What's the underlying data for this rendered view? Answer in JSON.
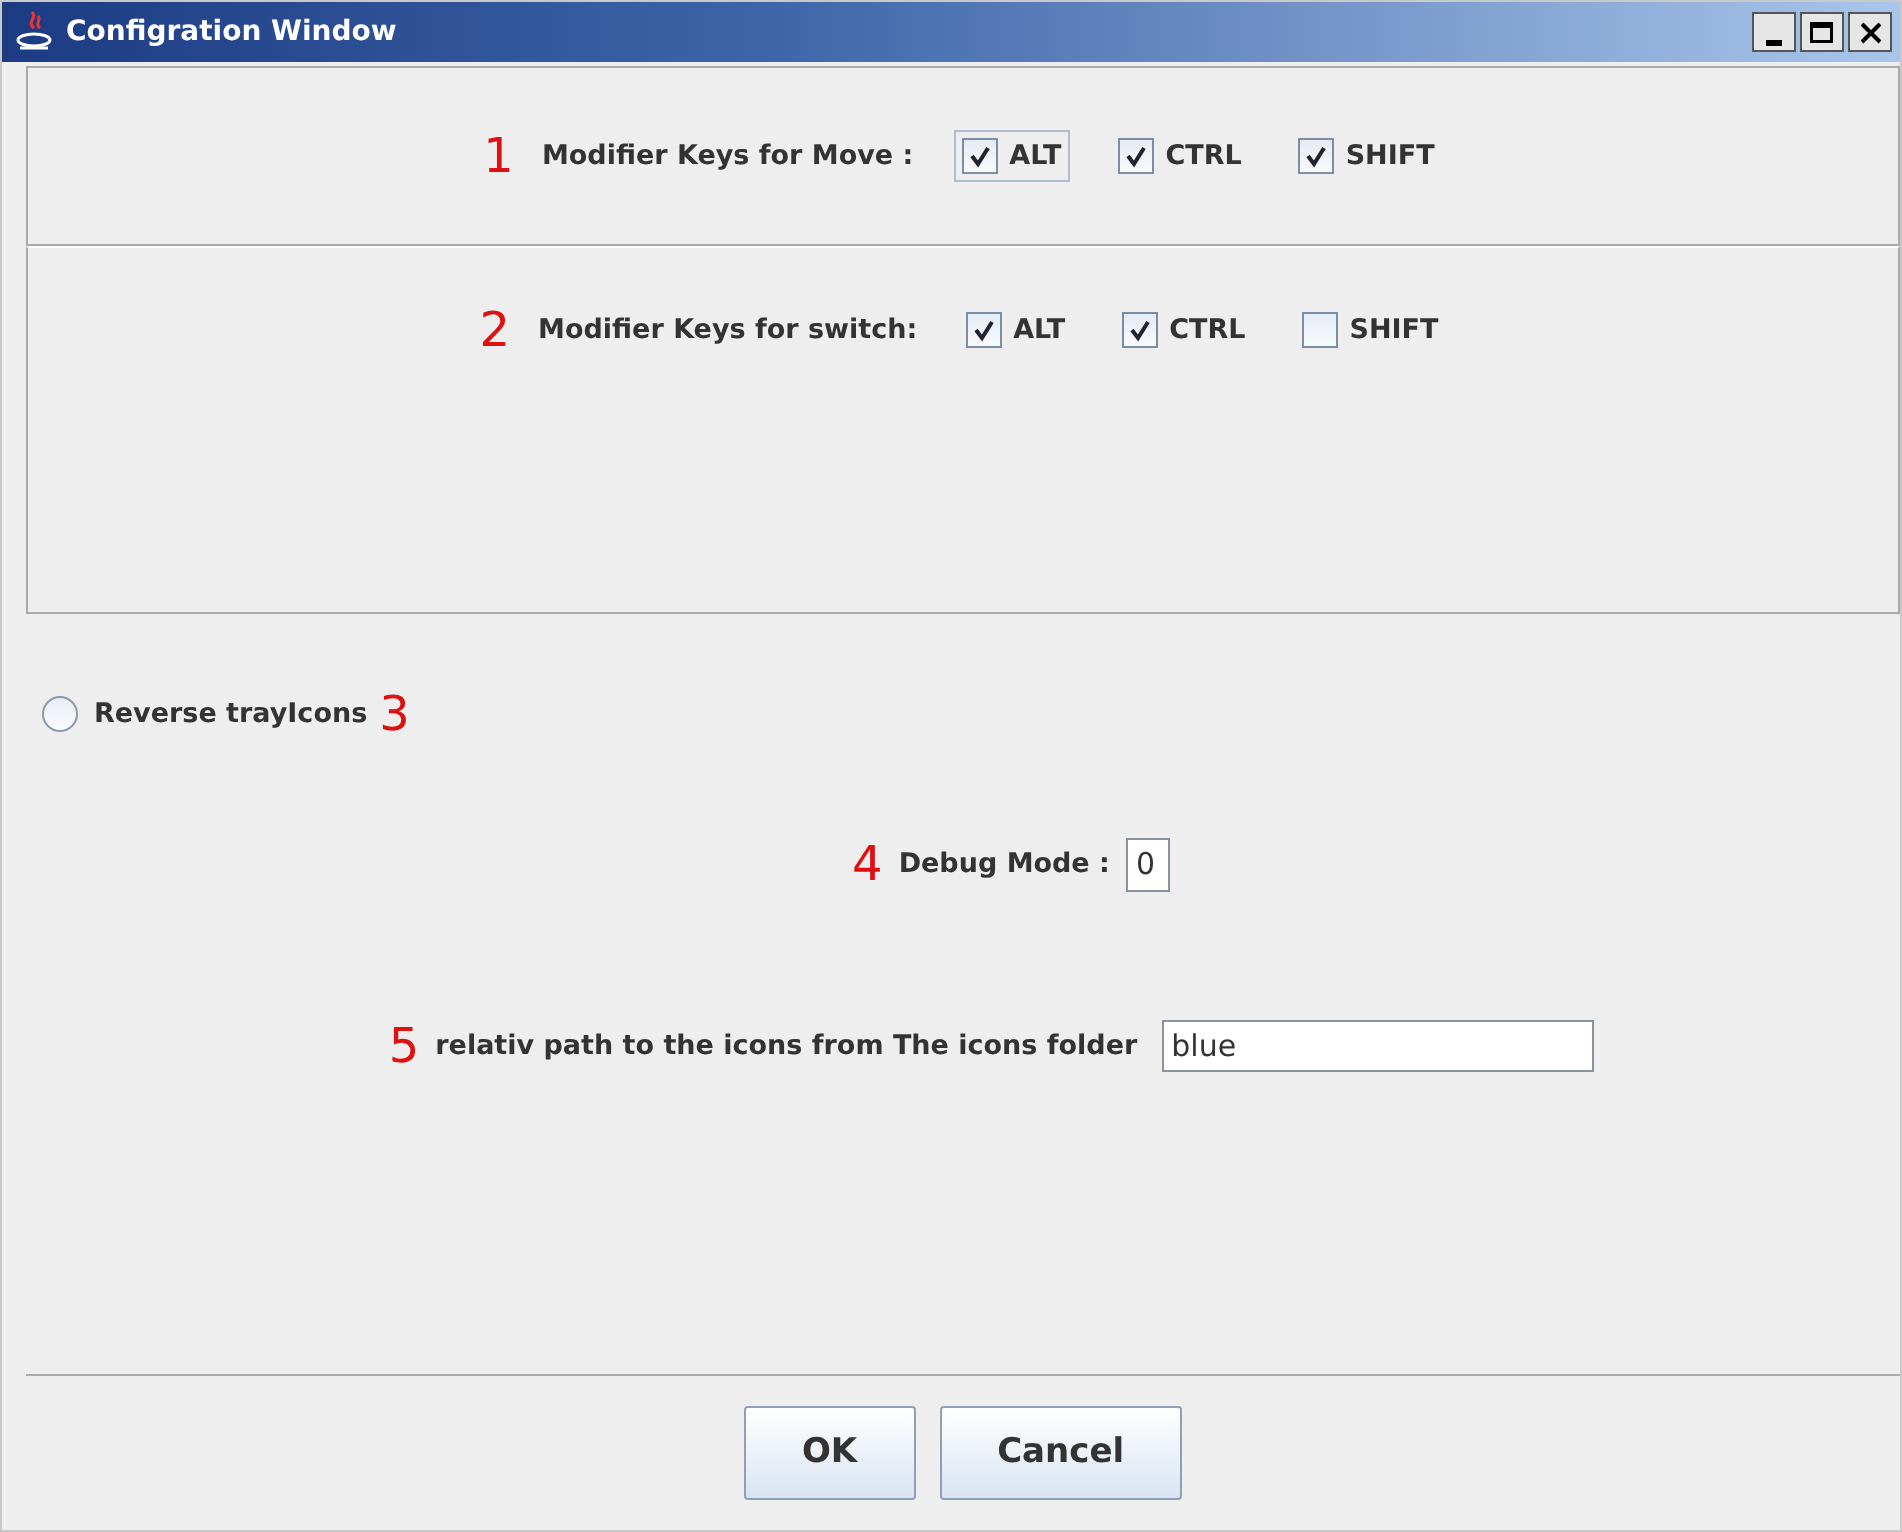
{
  "window": {
    "title": "Configration Window"
  },
  "move_keys": {
    "marker": "1",
    "label": "Modifier Keys for Move :",
    "options": [
      {
        "label": "ALT",
        "checked": true,
        "focused": true
      },
      {
        "label": "CTRL",
        "checked": true,
        "focused": false
      },
      {
        "label": "SHIFT",
        "checked": true,
        "focused": false
      }
    ]
  },
  "switch_keys": {
    "marker": "2",
    "label": "Modifier Keys for switch:",
    "options": [
      {
        "label": "ALT",
        "checked": true,
        "focused": false
      },
      {
        "label": "CTRL",
        "checked": true,
        "focused": false
      },
      {
        "label": "SHIFT",
        "checked": false,
        "focused": false
      }
    ]
  },
  "reverse_tray_icons": {
    "label": "Reverse trayIcons",
    "marker": "3",
    "selected": false
  },
  "debug_mode": {
    "marker": "4",
    "label": "Debug Mode :",
    "value": "0"
  },
  "icons_path": {
    "marker": "5",
    "label": "relativ path to the icons from The icons folder",
    "value": "blue"
  },
  "buttons": [
    "OK",
    "Cancel"
  ]
}
